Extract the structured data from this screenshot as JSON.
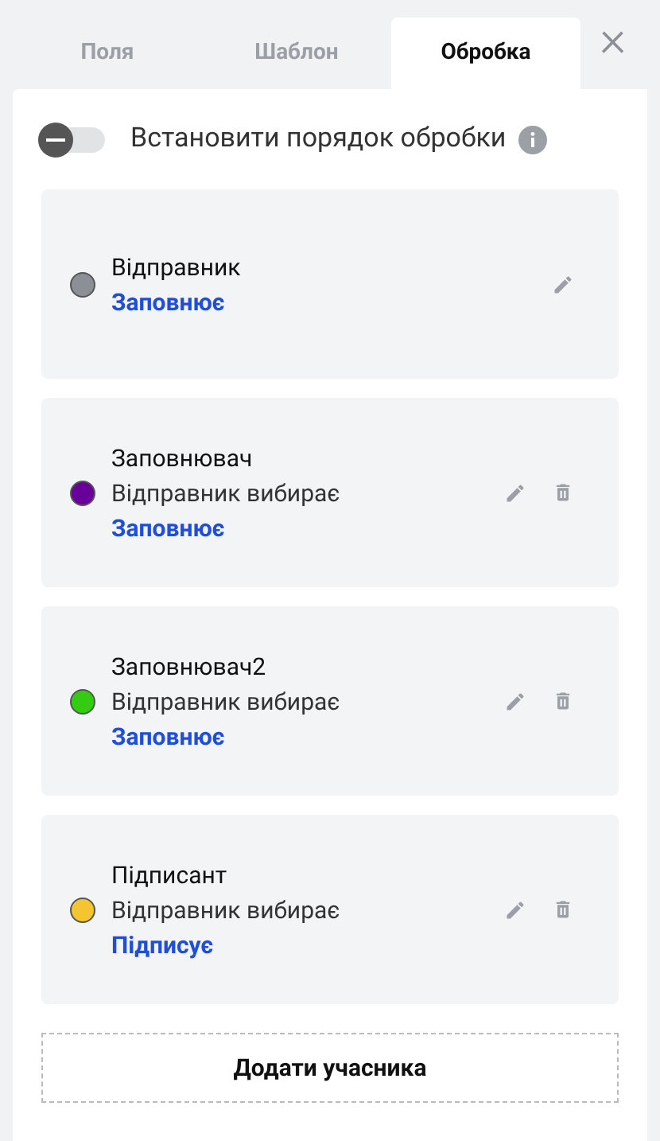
{
  "tabs": [
    {
      "label": "Поля",
      "selected": false
    },
    {
      "label": "Шаблон",
      "selected": false
    },
    {
      "label": "Обробка",
      "selected": true
    }
  ],
  "close": {
    "label": "×"
  },
  "order_toggle": {
    "label": "Встановити порядок обробки",
    "on": false
  },
  "participants": [
    {
      "name": "Відправник",
      "color": "#8b9096",
      "role": "Заповнює",
      "deletable": false
    },
    {
      "name": "Заповнювач",
      "color": "#6a0099",
      "chooser": "Відправник вибирає",
      "role": "Заповнює",
      "deletable": true
    },
    {
      "name": "Заповнювач2",
      "color": "#33cc11",
      "chooser": "Відправник вибирає",
      "role": "Заповнює",
      "deletable": true
    },
    {
      "name": "Підписант",
      "color": "#f5c531",
      "chooser": "Відправник вибирає",
      "role": "Підписує",
      "deletable": true
    }
  ],
  "add_button": {
    "label": "Додати учасника"
  }
}
